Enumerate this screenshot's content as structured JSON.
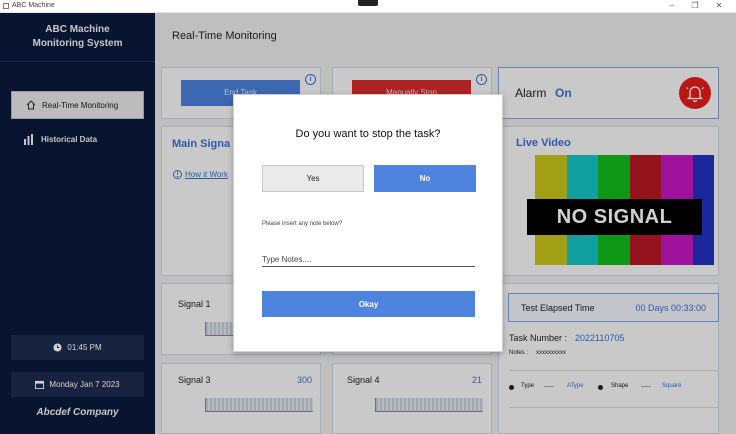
{
  "window": {
    "title": "ABC Machine",
    "minimize": "–",
    "maximize": "❐",
    "close": "✕"
  },
  "sidebar": {
    "brand_line1": "ABC Machine",
    "brand_line2": "Monitoring System",
    "nav": [
      {
        "label": "Real-Time Monitoring",
        "icon": "home-icon",
        "active": true
      },
      {
        "label": "Historical Data",
        "icon": "chart-icon",
        "active": false
      }
    ],
    "time": "01:45 PM",
    "date": "Monday Jan 7 2023",
    "company": "Abcdef Company"
  },
  "main": {
    "title": "Real-Time Monitoring",
    "end_task_label": "End Task",
    "manually_stop_label": "Manually Stop",
    "alarm": {
      "label": "Alarm",
      "status": "On"
    },
    "main_signal_title": "Main Signa",
    "how_it_works": "How it Work",
    "live_video_title": "Live Video",
    "no_signal": "NO SIGNAL",
    "signals": [
      {
        "label": "Signal 1",
        "value": ""
      },
      {
        "label": "Signal 3",
        "value": "300"
      },
      {
        "label": "Signal 4",
        "value": "21"
      }
    ],
    "elapsed": {
      "label": "Test Elapsed Time",
      "value": "00 Days 00:33:00"
    },
    "task": {
      "label": "Task Number :",
      "value": "2022110705"
    },
    "notes": {
      "label": "Notes :",
      "value": "xxxxxxxxxx"
    },
    "legend": {
      "type_label": "Type",
      "type_value": "AType",
      "shape_label": "Shape",
      "shape_value": "Square"
    }
  },
  "dialog": {
    "question": "Do you want to stop the task?",
    "yes": "Yes",
    "no": "No",
    "note_prompt": "Please insert any note below?",
    "notes_placeholder": "Type Notes....",
    "okay": "Okay"
  },
  "colors": {
    "sidebar_bg": "#0c1a3b",
    "accent_blue": "#4f83e0",
    "alarm_red": "#e31b1b",
    "stop_red": "#d12b2b"
  }
}
